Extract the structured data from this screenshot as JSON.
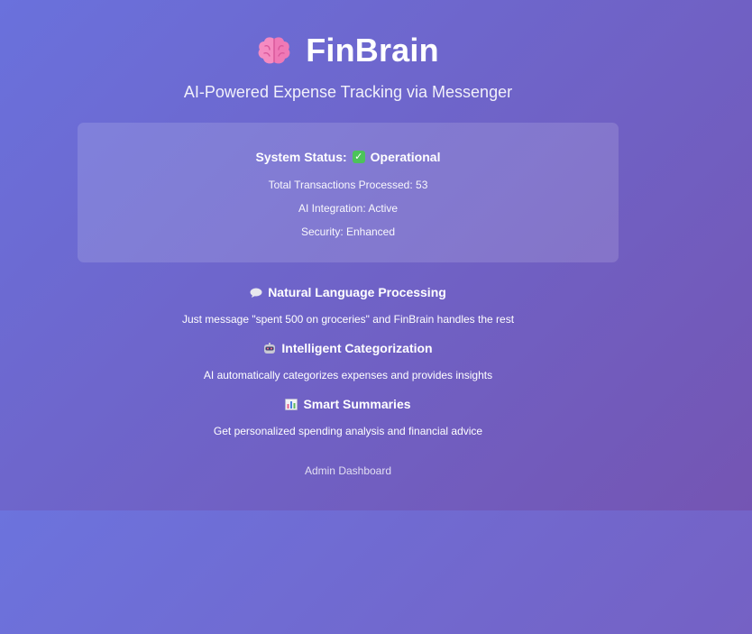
{
  "app": {
    "title": "FinBrain",
    "tagline": "AI-Powered Expense Tracking via Messenger",
    "brain_icon": "brain-icon",
    "brand_color": "#f472b6"
  },
  "status": {
    "label": "System Status:",
    "value": "Operational",
    "value_icon": "check-mark-icon",
    "lines": [
      "Total Transactions Processed: 53",
      "AI Integration: Active",
      "Security: Enhanced"
    ],
    "status_color": "#4cc35a"
  },
  "features": [
    {
      "icon": "speech-bubble-icon",
      "title": "Natural Language Processing",
      "description": "Just message \"spent 500 on groceries\" and FinBrain handles the rest"
    },
    {
      "icon": "robot-icon",
      "title": "Intelligent Categorization",
      "description": "AI automatically categorizes expenses and provides insights"
    },
    {
      "icon": "bar-chart-icon",
      "title": "Smart Summaries",
      "description": "Get personalized spending analysis and financial advice"
    }
  ],
  "footer": {
    "admin_link": "Admin Dashboard"
  }
}
